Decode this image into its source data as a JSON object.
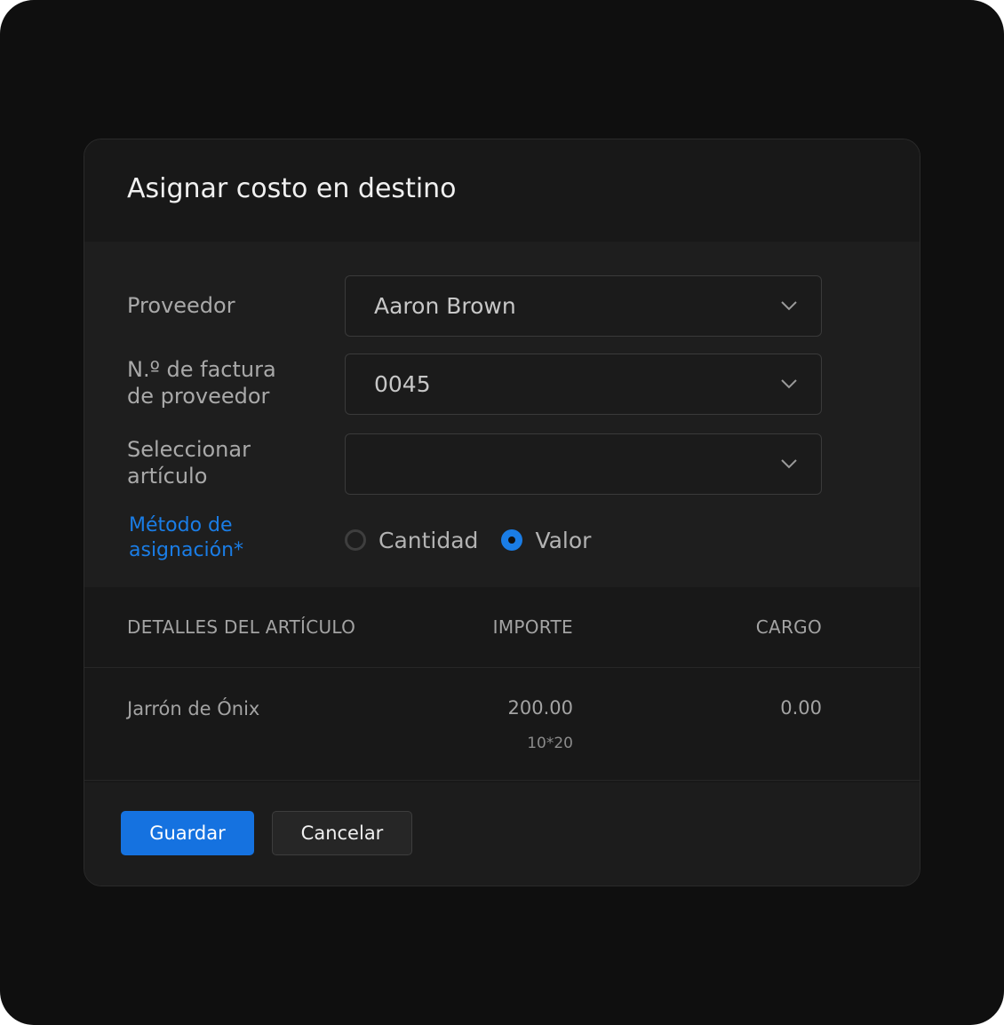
{
  "dialog": {
    "title": "Asignar costo en destino"
  },
  "form": {
    "vendor": {
      "label": "Proveedor",
      "value": "Aaron Brown"
    },
    "invoice": {
      "label": "N.º de factura\nde proveedor",
      "value": "0045"
    },
    "item": {
      "label": "Seleccionar\nartículo",
      "value": ""
    },
    "method": {
      "label": "Método de\nasignación*",
      "options": [
        {
          "label": "Cantidad",
          "checked": false
        },
        {
          "label": "Valor",
          "checked": true
        }
      ]
    }
  },
  "table": {
    "headers": [
      "DETALLES DEL ARTÍCULO",
      "IMPORTE",
      "CARGO"
    ],
    "rows": [
      {
        "item": "Jarrón de Ónix",
        "amount": "200.00",
        "amount_detail": "10*20",
        "charge": "0.00"
      }
    ]
  },
  "actions": {
    "save_label": "Guardar",
    "cancel_label": "Cancelar"
  },
  "colors": {
    "accent": "#1572e0",
    "label_accent": "#1a7de6",
    "background": "#0f0f0f"
  },
  "icons": {
    "dropdown": "chevron-down-icon"
  }
}
